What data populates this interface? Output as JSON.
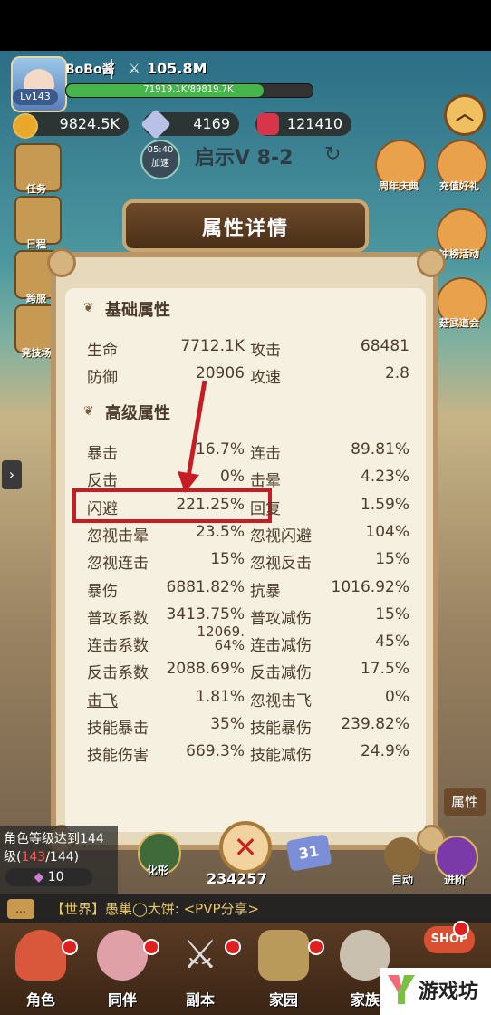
{
  "player": {
    "name": "BoBo酱",
    "level": "Lv143",
    "power": "105.8M",
    "hp_text": "71919.1K/89819.7K",
    "hp_fraction": 0.8
  },
  "resources": {
    "gold": "9824.5K",
    "crystal": "4169",
    "gem": "121410"
  },
  "stage": {
    "label": "启示V 8-2",
    "timer": "05:40",
    "timer_label": "加速"
  },
  "left_menu": [
    "任务",
    "日程",
    "跨服",
    "竞技场"
  ],
  "right_menu": [
    "周年庆典",
    "充值好礼",
    "冲榜活动",
    "菇武道会"
  ],
  "popup": {
    "title": "属性详情",
    "basic_title": "基础属性",
    "basic_rows": [
      {
        "k1": "生命",
        "v1": "7712.1K",
        "k2": "攻击",
        "v2": "68481"
      },
      {
        "k1": "防御",
        "v1": "20906",
        "k2": "攻速",
        "v2": "2.8"
      }
    ],
    "advanced_title": "高级属性",
    "advanced_rows": [
      {
        "k1": "暴击",
        "v1": "16.7%",
        "k2": "连击",
        "v2": "89.81%"
      },
      {
        "k1": "反击",
        "v1": "0%",
        "k2": "击晕",
        "v2": "4.23%"
      },
      {
        "k1": "闪避",
        "v1": "221.25%",
        "k2": "回复",
        "v2": "1.59%"
      },
      {
        "k1": "忽视击晕",
        "v1": "23.5%",
        "k2": "忽视闪避",
        "v2": "104%"
      },
      {
        "k1": "忽视连击",
        "v1": "15%",
        "k2": "忽视反击",
        "v2": "15%"
      },
      {
        "k1": "暴伤",
        "v1": "6881.82%",
        "k2": "抗暴",
        "v2": "1016.92%"
      },
      {
        "k1": "普攻系数",
        "v1": "3413.75%",
        "k2": "普攻减伤",
        "v2": "15%"
      },
      {
        "k1": "连击系数",
        "v1": "12069.\n64%",
        "k2": "连击减伤",
        "v2": "45%"
      },
      {
        "k1": "反击系数",
        "v1": "2088.69%",
        "k2": "反击减伤",
        "v2": "17.5%"
      },
      {
        "k1": "击飞",
        "v1": "1.81%",
        "k2": "忽视击飞",
        "v2": "0%"
      },
      {
        "k1": "技能暴击",
        "v1": "35%",
        "k2": "技能暴伤",
        "v2": "239.82%"
      },
      {
        "k1": "技能伤害",
        "v1": "669.3%",
        "k2": "技能减伤",
        "v2": "24.9%"
      }
    ],
    "highlighted_row": "闪避"
  },
  "quest": {
    "text": "角色等级达到144级(",
    "progress_cur": "143",
    "progress_sep": "/144)",
    "reward": "10"
  },
  "battle": {
    "count": "234257",
    "badge": "31",
    "morph": "化形",
    "auto": "自动",
    "advance": "进阶",
    "attr_tab": "属性"
  },
  "chat": {
    "text": "【世界】愚巢◯大饼: <PVP分享>"
  },
  "nav": [
    "角色",
    "同伴",
    "副本",
    "家园",
    "家族"
  ],
  "shop": "SHOP",
  "watermark": "游戏坊"
}
